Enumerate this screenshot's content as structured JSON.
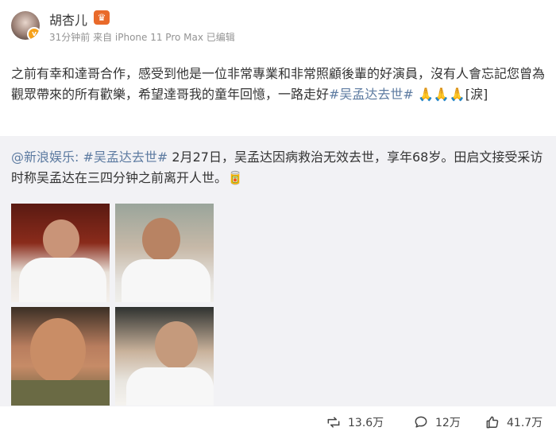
{
  "author": {
    "name": "胡杏儿",
    "meta": "31分钟前 来自 iPhone 11 Pro Max 已编辑"
  },
  "post": {
    "text": "之前有幸和達哥合作，感受到他是一位非常專業和非常照顧後輩的好演員，沒有人會忘記您曾為觀眾帶來的所有歡樂，希望達哥我的童年回憶，一路走好",
    "hashtag": "#吴孟达去世#",
    "emoji": "🙏🙏🙏",
    "tail": "[淚]"
  },
  "repost": {
    "source": "@新浪娱乐:",
    "hashtag": "#吴孟达去世#",
    "text": " 2月27日，吴孟达因病救治无效去世，享年68岁。田启文接受采访时称吴孟达在三四分钟之前离开人世。",
    "emoji": "🥫"
  },
  "actions": {
    "repost_count": "13.6万",
    "comment_count": "12万",
    "like_count": "41.7万"
  }
}
